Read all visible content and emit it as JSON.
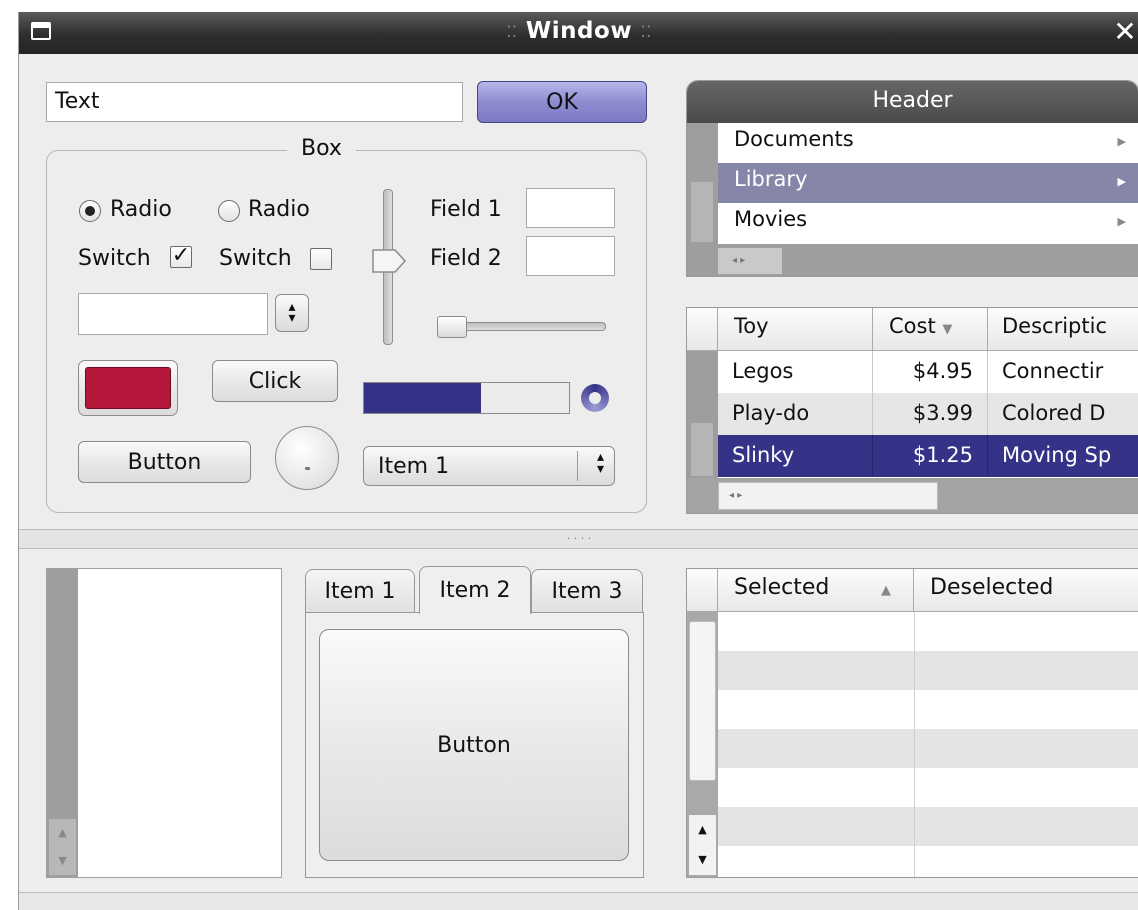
{
  "window": {
    "title": "Window"
  },
  "top_left": {
    "text_field_value": "Text",
    "ok_label": "OK",
    "box": {
      "legend": "Box",
      "radio1_label": "Radio",
      "radio2_label": "Radio",
      "radio1_selected": true,
      "radio2_selected": false,
      "switch1_label": "Switch",
      "switch2_label": "Switch",
      "switch1_checked": true,
      "switch2_checked": false,
      "checkmark": "✓",
      "field1_label": "Field 1",
      "field2_label": "Field 2",
      "field1_value": "",
      "field2_value": "",
      "spin_value": "",
      "color_swatch": "#b5173a",
      "click_label": "Click",
      "button_label": "Button",
      "select_value": "Item 1",
      "progress_fraction": 0.57
    }
  },
  "menu_list": {
    "header": "Header",
    "items": [
      {
        "label": "Documents",
        "arrow": "▶"
      },
      {
        "label": "Library",
        "arrow": "▶"
      },
      {
        "label": "Movies",
        "arrow": "▶"
      }
    ]
  },
  "toy_table": {
    "columns": [
      "Toy",
      "Cost",
      "Descriptic"
    ],
    "rows": [
      {
        "toy": "Legos",
        "cost": "$4.95",
        "desc": "Connectir"
      },
      {
        "toy": "Play-do",
        "cost": "$3.99",
        "desc": "Colored D"
      },
      {
        "toy": "Slinky",
        "cost": "$1.25",
        "desc": "Moving Sp"
      }
    ]
  },
  "tabs": {
    "labels": [
      "Item 1",
      "Item 2",
      "Item 3"
    ],
    "active_index": 1,
    "panel_button_label": "Button"
  },
  "sel_table": {
    "columns": [
      "Selected",
      "Deselected"
    ]
  },
  "colors": {
    "selection": "#343387",
    "ok_button": "#8e8cd0"
  }
}
